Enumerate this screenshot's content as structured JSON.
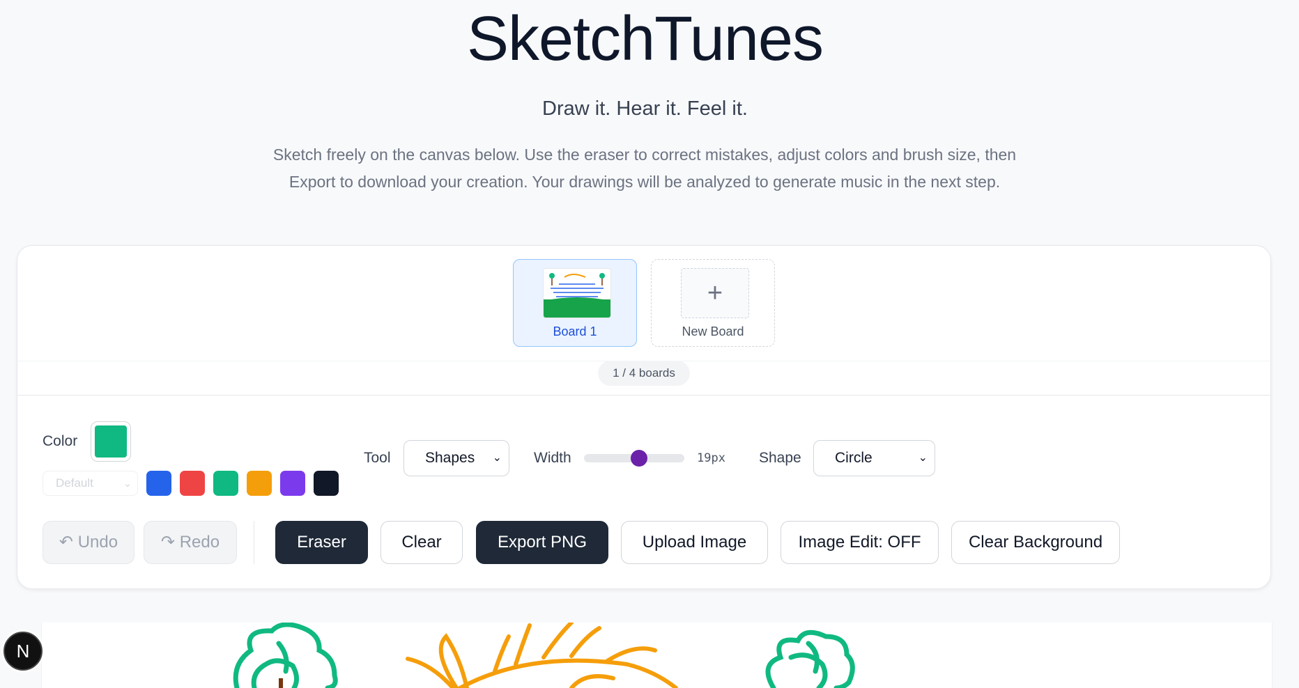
{
  "header": {
    "title": "SketchTunes",
    "tagline": "Draw it. Hear it. Feel it.",
    "description_line1": "Sketch freely on the canvas below. Use the eraser to correct mistakes, adjust colors and brush size, then",
    "description_line2": "Export to download your creation. Your drawings will be analyzed to generate music in the next step."
  },
  "boards": {
    "items": [
      {
        "label": "Board 1",
        "active": true
      },
      {
        "label": "New Board",
        "icon": "plus-icon"
      }
    ],
    "count": "1 / 4 boards"
  },
  "toolbar": {
    "color_label": "Color",
    "current_color": "#10b981",
    "palette_placeholder": "Default",
    "swatches": [
      "#2563eb",
      "#ef4444",
      "#10b981",
      "#f59e0b",
      "#7c3aed",
      "#111827"
    ],
    "tool_label": "Tool",
    "tool_value": "Shapes",
    "width_label": "Width",
    "width_value": "19px",
    "width_fraction": 0.55,
    "shape_label": "Shape",
    "shape_value": "Circle"
  },
  "actions": {
    "undo": "↶ Undo",
    "redo": "↷ Redo",
    "eraser": "Eraser",
    "clear": "Clear",
    "export": "Export PNG",
    "upload": "Upload Image",
    "image_edit": "Image Edit: OFF",
    "clear_background": "Clear Background"
  },
  "badge": {
    "letter": "N"
  },
  "colors": {
    "accent_dark": "#1f2937",
    "slider_thumb": "#6b21a8",
    "stroke_green": "#10b981",
    "stroke_orange": "#f59e0b"
  }
}
